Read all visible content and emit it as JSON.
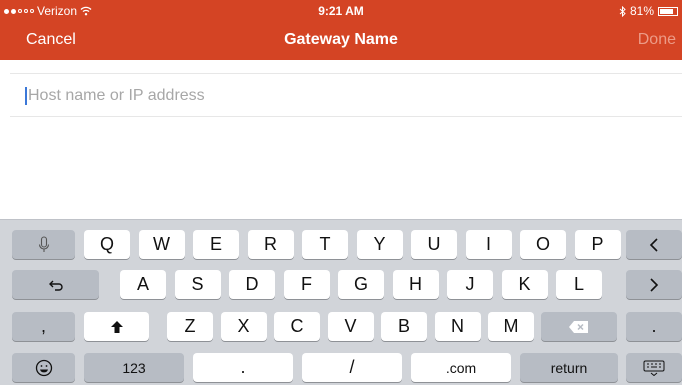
{
  "status_bar": {
    "carrier": "Verizon",
    "time": "9:21 AM",
    "battery": "81%",
    "battery_level": 0.81
  },
  "nav": {
    "cancel": "Cancel",
    "title": "Gateway Name",
    "done": "Done"
  },
  "input": {
    "placeholder": "Host name or IP address",
    "value": ""
  },
  "keyboard": {
    "row1": [
      "Q",
      "W",
      "E",
      "R",
      "T",
      "Y",
      "U",
      "I",
      "O",
      "P"
    ],
    "row2": [
      "A",
      "S",
      "D",
      "F",
      "G",
      "H",
      "J",
      "K",
      "L"
    ],
    "row3": [
      "Z",
      "X",
      "C",
      "V",
      "B",
      "N",
      "M"
    ],
    "comma": ",",
    "period": ".",
    "numbers": "123",
    "dot": ".",
    "slash": "/",
    "dotcom": ".com",
    "return": "return"
  },
  "icons": {
    "mic": "microphone-icon",
    "undo": "undo-icon",
    "shift": "shift-icon",
    "delete": "delete-icon",
    "emoji": "emoji-icon",
    "prev": "chevron-left-icon",
    "next": "chevron-right-icon",
    "hide": "keyboard-hide-icon",
    "wifi": "wifi-icon",
    "bluetooth": "bluetooth-icon"
  },
  "colors": {
    "header": "#d44424",
    "done_disabled": "#ec9b87",
    "caret": "#3b78d8",
    "keyboard_bg": "#d1d4d9"
  }
}
